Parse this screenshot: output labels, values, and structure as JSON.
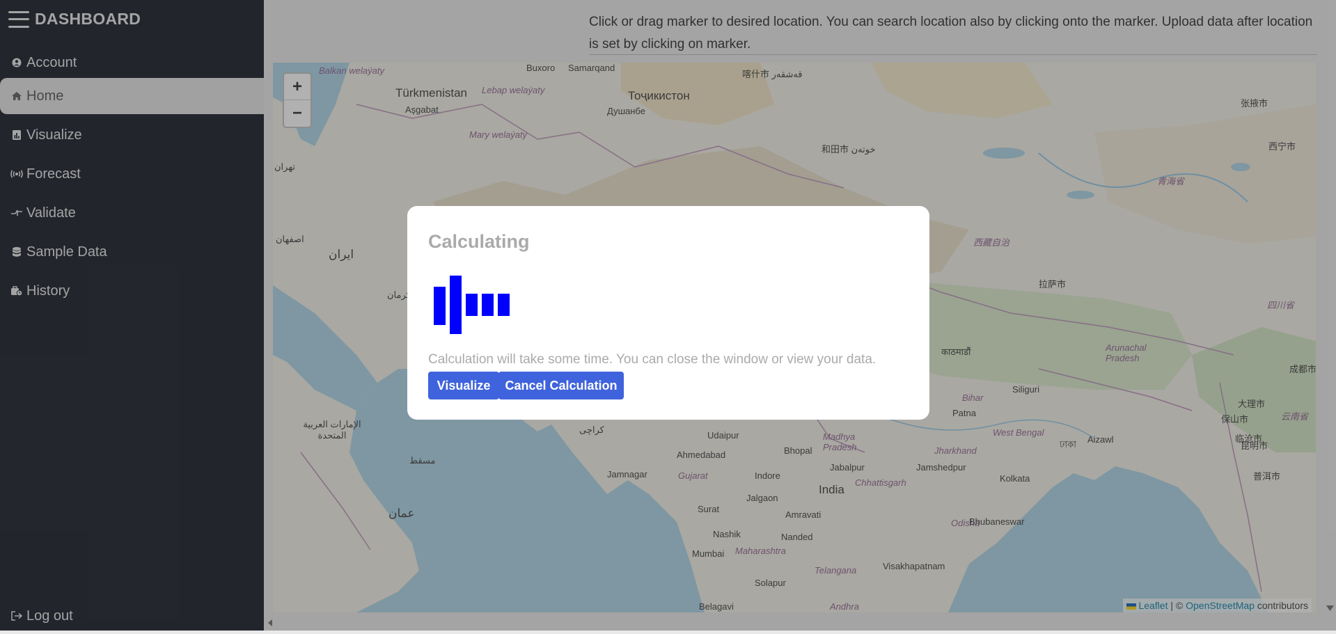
{
  "sidebar": {
    "title": "DASHBOARD",
    "items": [
      {
        "label": "Account",
        "icon": "user-circle-icon"
      },
      {
        "label": "Home",
        "icon": "home-icon"
      },
      {
        "label": "Visualize",
        "icon": "chart-icon"
      },
      {
        "label": "Forecast",
        "icon": "broadcast-icon"
      },
      {
        "label": "Validate",
        "icon": "compare-icon"
      },
      {
        "label": "Sample Data",
        "icon": "database-icon"
      },
      {
        "label": "History",
        "icon": "history-icon"
      }
    ],
    "logout": "Log out",
    "active": "Home"
  },
  "header": {
    "instruction": "Click or drag marker to desired location. You can search location also by clicking onto the marker. Upload data after location is set by clicking on marker."
  },
  "map": {
    "zoom_in": "+",
    "zoom_out": "−",
    "attribution_leaflet": "Leaflet",
    "attribution_sep": " | © ",
    "attribution_osm": "OpenStreetMap",
    "attribution_suffix": " contributors",
    "labels": {
      "balkan": "Balkan welaýaty",
      "turkmenistan": "Türkmenistan",
      "lebap": "Lebap welaýaty",
      "asgabat": "Aşgabat",
      "mary": "Mary welaýaty",
      "buxoro": "Buxoro",
      "samarqand": "Samarqand",
      "tojikiston": "Тоҷикистон",
      "dushanbe": "Душанбе",
      "kashgar": "喀什市 قەشقەر",
      "hotan": "和田市 خوتەن",
      "iran": "ایران",
      "isfahan": "اصفهان",
      "tehran": "تهران",
      "kerman": "کرمان",
      "xizang": "西藏自治",
      "lhasa": "拉萨市",
      "qinghai": "青海省",
      "sichuan": "四川省",
      "xining": "西宁市",
      "zhangye": "张掖市",
      "arunachal": "Arunachal Pradesh",
      "kathmandu": "काठमाडौं",
      "siliguri": "Siliguri",
      "patna": "Patna",
      "bihar": "Bihar",
      "westbengal": "West Bengal",
      "dhaka": "ঢাকা",
      "kolkata": "Kolkata",
      "jamshedpur": "Jamshedpur",
      "jharkhand": "Jharkhand",
      "india": "India",
      "madhya": "Madhya Pradesh",
      "bhopal": "Bhopal",
      "indore": "Indore",
      "jabalpur": "Jabalpur",
      "udaipur": "Udaipur",
      "ahmedabad": "Ahmedabad",
      "gujarat": "Gujarat",
      "jamnagar": "Jamnagar",
      "surat": "Surat",
      "jalgaon": "Jalgaon",
      "amravati": "Amravati",
      "nashik": "Nashik",
      "nanded": "Nanded",
      "mumbai": "Mumbai",
      "maharashtra": "Maharashtra",
      "telangana": "Telangana",
      "visakhapatnam": "Visakhapatnam",
      "odisha": "Odisha",
      "bhubaneswar": "Bhubaneswar",
      "chhattisgarh": "Chhattisgarh",
      "solapur": "Solapur",
      "belagavi": "Belagavi",
      "andhra": "Andhra",
      "karachi": "کراچی",
      "uae": "الإمارات العربية المتحدة",
      "oman": "عمان",
      "muscat": "مسقط",
      "aizawl": "Aizawl",
      "kunming": "昆明市",
      "dali": "大理市",
      "lincang": "临沧市",
      "puer": "普洱市",
      "yunnan": "云南省",
      "chengdu": "成都市",
      "baoshan": "保山市"
    }
  },
  "modal": {
    "title": "Calculating",
    "message": "Calculation will take some time. You can close the window or view your data.",
    "visualize_button": "Visualize",
    "cancel_button": "Cancel Calculation"
  },
  "colors": {
    "sidebar_bg": "#0b0f1c",
    "accent_button": "#3f63dc",
    "loader": "#0000ff"
  }
}
